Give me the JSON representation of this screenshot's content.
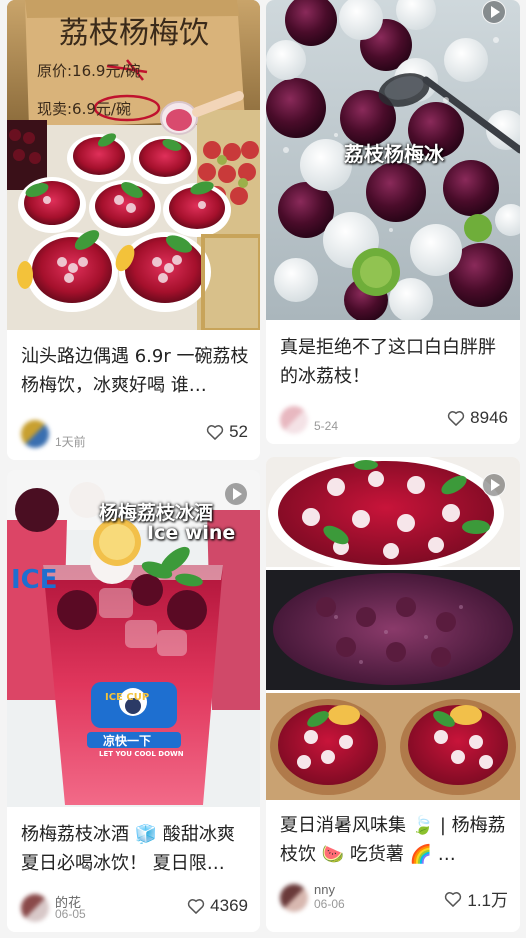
{
  "feed": [
    {
      "image_text": [
        "荔枝杨梅饮",
        "原价:16.9元/碗",
        "现卖:6.9元/碗"
      ],
      "title": "汕头路边偶遇 6.9r 一碗荔枝杨梅饮，冰爽好喝 谁…",
      "author": "",
      "date": "1天前",
      "likes": "52",
      "has_video": false
    },
    {
      "image_text": [
        "荔枝杨梅冰"
      ],
      "title": "真是拒绝不了这口白白胖胖的冰荔枝！",
      "author": "",
      "date": "5-24",
      "likes": "8946",
      "has_video": true
    },
    {
      "image_text": [
        "杨梅荔枝冰酒",
        "Ice wine",
        "ICE CUP",
        "凉快一下",
        "LET YOU COOL DOWN"
      ],
      "title": "杨梅荔枝冰酒 🧊 酸甜冰爽 夏日必喝冰饮！ 夏日限…",
      "author": "的花",
      "date": "06-05",
      "likes": "4369",
      "has_video": true
    },
    {
      "image_text": [],
      "title": "夏日消暑风味集 🍃 | 杨梅荔枝饮 🍉 吃货薯 🌈 …",
      "author": "nny",
      "date": "06-06",
      "likes": "1.1万",
      "has_video": true
    }
  ],
  "colors": {
    "page_bg": "#f4f4f4",
    "card_bg": "#ffffff",
    "text_primary": "#222222",
    "text_secondary": "#999999",
    "accent_red": "#c0122e"
  },
  "icons": {
    "like": "heart-outline-icon",
    "video": "play-icon"
  }
}
